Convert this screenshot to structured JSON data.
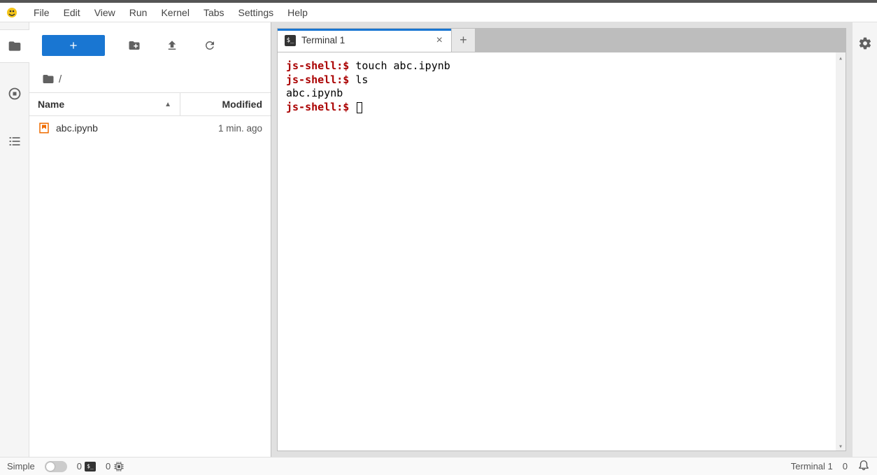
{
  "menu": {
    "items": [
      "File",
      "Edit",
      "View",
      "Run",
      "Kernel",
      "Tabs",
      "Settings",
      "Help"
    ]
  },
  "file_browser": {
    "breadcrumb": "/",
    "columns": {
      "name": "Name",
      "modified": "Modified"
    },
    "rows": [
      {
        "name": "abc.ipynb",
        "modified": "1 min. ago"
      }
    ]
  },
  "tabs": {
    "items": [
      {
        "label": "Terminal 1"
      }
    ]
  },
  "terminal": {
    "prompt": "js-shell:$",
    "lines": [
      {
        "type": "cmd",
        "text": "touch abc.ipynb"
      },
      {
        "type": "cmd",
        "text": "ls"
      },
      {
        "type": "out",
        "text": "abc.ipynb"
      },
      {
        "type": "cmd",
        "text": ""
      }
    ]
  },
  "status": {
    "simple_label": "Simple",
    "left_counts": {
      "a": "0",
      "b": "0"
    },
    "right_label": "Terminal 1",
    "right_count": "0"
  }
}
